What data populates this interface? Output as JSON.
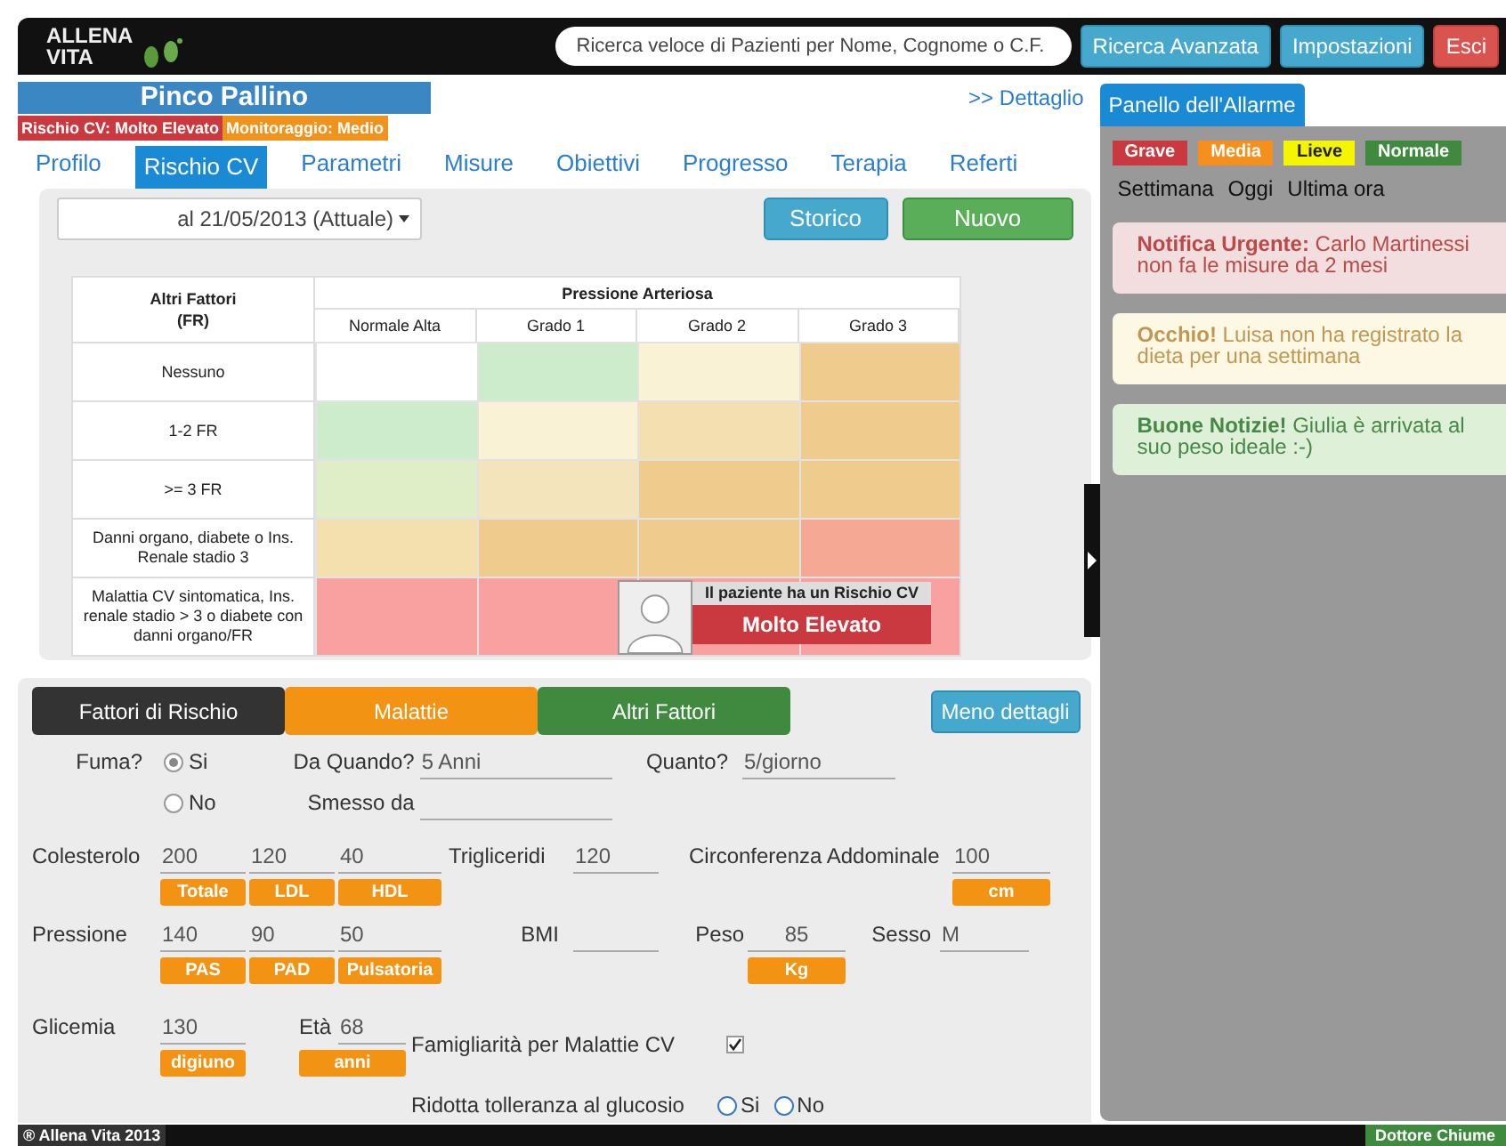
{
  "header": {
    "logo": [
      "ALLENA",
      "VITA"
    ],
    "search": {
      "placeholder": "Ricerca veloce di Pazienti per Nome, Cognome o C.F."
    },
    "buttons": [
      {
        "label": "Ricerca Avanzata",
        "kind": "info"
      },
      {
        "label": "Impostazioni",
        "kind": "info"
      },
      {
        "label": "Esci",
        "kind": "danger"
      }
    ]
  },
  "patient": {
    "name": "Pinco Pallino",
    "badges": [
      {
        "label": "Rischio CV: Molto Elevato",
        "color": "#c9393f"
      },
      {
        "label": "Monitoraggio: Medio",
        "color": "#f0931d"
      }
    ],
    "detail_link": ">> Dettaglio"
  },
  "tabs": [
    {
      "label": "Profilo",
      "selected": false
    },
    {
      "label": "Rischio CV",
      "selected": true
    },
    {
      "label": "Parametri",
      "selected": false
    },
    {
      "label": "Misure",
      "selected": false
    },
    {
      "label": "Obiettivi",
      "selected": false
    },
    {
      "label": "Progresso",
      "selected": false
    },
    {
      "label": "Terapia",
      "selected": false
    },
    {
      "label": "Referti",
      "selected": false
    }
  ],
  "risk": {
    "date_select": "al 21/05/2013 (Attuale)",
    "buttons": [
      {
        "label": "Storico",
        "kind": "info"
      },
      {
        "label": "Nuovo",
        "kind": "success"
      }
    ],
    "table": {
      "corner": "Altri Fattori (FR)",
      "group": "Pressione Arteriosa",
      "columns": [
        "Normale Alta",
        "Grado 1",
        "Grado 2",
        "Grado 3"
      ],
      "rows": [
        {
          "label": "Nessuno",
          "cells": [
            {
              "color": "#ffffff"
            },
            {
              "color": "#cdeccc"
            },
            {
              "color": "#faf2d4"
            },
            {
              "color": "#efcc8e"
            }
          ]
        },
        {
          "label": "1-2 FR",
          "cells": [
            {
              "color": "#cdeccc"
            },
            {
              "color": "#faf2d4"
            },
            {
              "color": "#f4dfb0"
            },
            {
              "color": "#efcc8e"
            }
          ]
        },
        {
          "label": ">= 3 FR",
          "cells": [
            {
              "color": "#e0eec8"
            },
            {
              "color": "#f4e4bc"
            },
            {
              "color": "#efcc8e"
            },
            {
              "color": "#efcc8e"
            }
          ]
        },
        {
          "label": "Danni organo, diabete o Ins. Renale stadio 3",
          "cells": [
            {
              "color": "#f4dfae"
            },
            {
              "color": "#efcc8e"
            },
            {
              "color": "#efcc8e"
            },
            {
              "color": "#f5a994"
            }
          ]
        },
        {
          "label": "Malattia CV sintomatica, Ins. renale stadio > 3 o diabete con danni organo/FR",
          "cells": [
            {
              "color": "#f9a0a0"
            },
            {
              "color": "#f9a0a0"
            },
            {
              "color": "#f9a0a0"
            },
            {
              "color": "#f9a0a0"
            }
          ]
        }
      ]
    },
    "result": {
      "caption": "Il paziente ha un Rischio CV",
      "level": "Molto Elevato"
    }
  },
  "form": {
    "categories": [
      {
        "label": "Fattori di Rischio",
        "color": "#333333"
      },
      {
        "label": "Malattie",
        "color": "#f39313"
      },
      {
        "label": "Altri Fattori",
        "color": "#3f8a3f"
      }
    ],
    "toggle": "Meno dettagli",
    "smoking": {
      "label": "Fuma?",
      "options": [
        {
          "label": "Si",
          "selected": true
        },
        {
          "label": "No",
          "selected": false
        }
      ],
      "since_label": "Da Quando?",
      "since_value": "5 Anni",
      "quantity_label": "Quanto?",
      "quantity_value": "5/giorno",
      "stopped_label": "Smesso da"
    },
    "cholesterol": {
      "label": "Colesterolo",
      "fields": [
        {
          "value": "200",
          "unit": "Totale"
        },
        {
          "value": "120",
          "unit": "LDL"
        },
        {
          "value": "40",
          "unit": "HDL"
        }
      ]
    },
    "triglycerides": {
      "label": "Trigliceridi",
      "value": "120"
    },
    "waist": {
      "label": "Circonferenza Addominale",
      "value": "100",
      "unit": "cm"
    },
    "pressure": {
      "label": "Pressione",
      "fields": [
        {
          "value": "140",
          "unit": "PAS"
        },
        {
          "value": "90",
          "unit": "PAD"
        },
        {
          "value": "50",
          "unit": "Pulsatoria"
        }
      ]
    },
    "bmi": {
      "label": "BMI"
    },
    "weight": {
      "label": "Peso",
      "value": "85",
      "unit": "Kg"
    },
    "sex": {
      "label": "Sesso",
      "value": "M"
    },
    "glycemia": {
      "label": "Glicemia",
      "value": "130",
      "unit": "digiuno"
    },
    "age": {
      "label": "Età",
      "value": "68",
      "unit": "anni"
    },
    "family_history": {
      "label": "Famigliarità per Malattie CV",
      "checked": true
    },
    "glucose_tolerance": {
      "label": "Ridotta tolleranza al glucosio",
      "options": [
        {
          "label": "Si",
          "selected": false
        },
        {
          "label": "No",
          "selected": false
        }
      ]
    }
  },
  "alarm_panel": {
    "title": "Panello dell'Allarme",
    "filters": [
      {
        "label": "Grave",
        "color": "#c9393f"
      },
      {
        "label": "Media",
        "color": "#f5901e"
      },
      {
        "label": "Lieve",
        "color": "#f5f500"
      },
      {
        "label": "Normale",
        "color": "#3f8a3f"
      }
    ],
    "periods": [
      "Settimana",
      "Oggi",
      "Ultima ora"
    ],
    "alerts": [
      {
        "kind": "danger",
        "text": "**Notifica Urgente:** Carlo Martinessi non fa le misure da 2 mesi"
      },
      {
        "kind": "warning",
        "text": "**Occhio!** Luisa non ha registrato la dieta per una settimana"
      },
      {
        "kind": "success",
        "text": "**Buone Notizie!** Giulia è arrivata al suo peso ideale :-)"
      }
    ]
  },
  "footer": {
    "copyright": "® Allena Vita 2013",
    "user": "Dottore Chiume"
  }
}
